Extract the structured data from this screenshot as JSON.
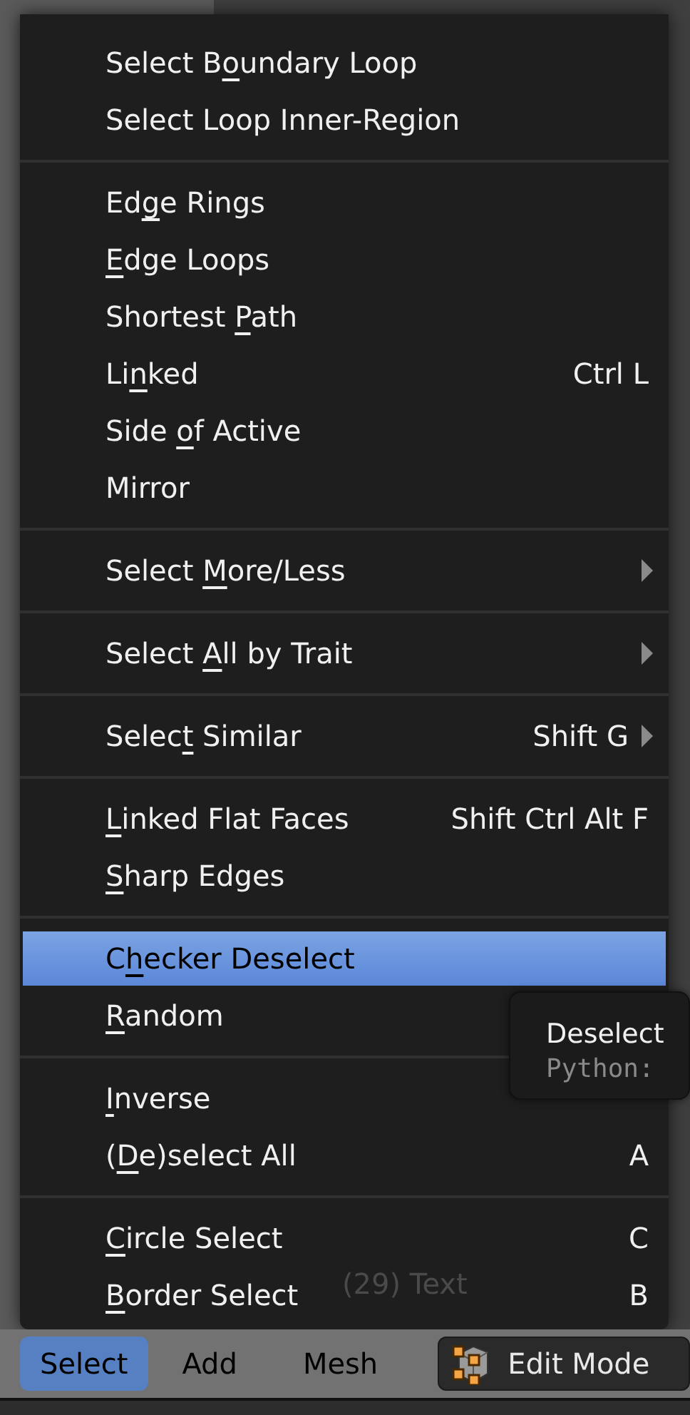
{
  "menu": {
    "sections": [
      {
        "items": [
          {
            "label_parts": [
              {
                "text": "Select B",
                "underlined": false
              },
              {
                "text": "o",
                "underlined": true
              },
              {
                "text": "undary Loop",
                "underlined": false
              }
            ],
            "selected": false,
            "submenu": false
          },
          {
            "label_parts": [
              {
                "text": "Select Loop Inner-Region",
                "underlined": false
              }
            ],
            "selected": false,
            "submenu": false
          }
        ]
      },
      {
        "items": [
          {
            "label_parts": [
              {
                "text": "Ed",
                "underlined": false
              },
              {
                "text": "g",
                "underlined": true
              },
              {
                "text": "e Rings",
                "underlined": false
              }
            ],
            "selected": false,
            "submenu": false
          },
          {
            "label_parts": [
              {
                "text": "E",
                "underlined": true
              },
              {
                "text": "dge Loops",
                "underlined": false
              }
            ],
            "selected": false,
            "submenu": false
          },
          {
            "label_parts": [
              {
                "text": "Shortest ",
                "underlined": false
              },
              {
                "text": "P",
                "underlined": true
              },
              {
                "text": "ath",
                "underlined": false
              }
            ],
            "selected": false,
            "submenu": false
          },
          {
            "label_parts": [
              {
                "text": "Li",
                "underlined": false
              },
              {
                "text": "n",
                "underlined": true
              },
              {
                "text": "ked",
                "underlined": false
              }
            ],
            "shortcut": "Ctrl L",
            "selected": false,
            "submenu": false
          },
          {
            "label_parts": [
              {
                "text": "Side ",
                "underlined": false
              },
              {
                "text": "o",
                "underlined": true
              },
              {
                "text": "f Active",
                "underlined": false
              }
            ],
            "selected": false,
            "submenu": false
          },
          {
            "label_parts": [
              {
                "text": "Mirror",
                "underlined": false
              }
            ],
            "selected": false,
            "submenu": false
          }
        ]
      },
      {
        "items": [
          {
            "label_parts": [
              {
                "text": "Select ",
                "underlined": false
              },
              {
                "text": "M",
                "underlined": true
              },
              {
                "text": "ore/Less",
                "underlined": false
              }
            ],
            "selected": false,
            "submenu": true
          }
        ]
      },
      {
        "items": [
          {
            "label_parts": [
              {
                "text": "Select ",
                "underlined": false
              },
              {
                "text": "A",
                "underlined": true
              },
              {
                "text": "ll by Trait",
                "underlined": false
              }
            ],
            "selected": false,
            "submenu": true
          }
        ]
      },
      {
        "items": [
          {
            "label_parts": [
              {
                "text": "Selec",
                "underlined": false
              },
              {
                "text": "t",
                "underlined": true
              },
              {
                "text": " Similar",
                "underlined": false
              }
            ],
            "shortcut": "Shift G",
            "selected": false,
            "submenu": true
          }
        ]
      },
      {
        "items": [
          {
            "label_parts": [
              {
                "text": "L",
                "underlined": true
              },
              {
                "text": "inked Flat Faces",
                "underlined": false
              }
            ],
            "shortcut": "Shift Ctrl Alt F",
            "selected": false,
            "submenu": false
          },
          {
            "label_parts": [
              {
                "text": "S",
                "underlined": true
              },
              {
                "text": "harp Edges",
                "underlined": false
              }
            ],
            "selected": false,
            "submenu": false
          }
        ]
      },
      {
        "items": [
          {
            "label_parts": [
              {
                "text": "C",
                "underlined": false
              },
              {
                "text": "h",
                "underlined": true
              },
              {
                "text": "ecker Deselect",
                "underlined": false
              }
            ],
            "selected": true,
            "submenu": false
          },
          {
            "label_parts": [
              {
                "text": "R",
                "underlined": true
              },
              {
                "text": "andom",
                "underlined": false
              }
            ],
            "selected": false,
            "submenu": false
          }
        ]
      },
      {
        "items": [
          {
            "label_parts": [
              {
                "text": "I",
                "underlined": true
              },
              {
                "text": "nverse",
                "underlined": false
              }
            ],
            "selected": false,
            "submenu": false
          },
          {
            "label_parts": [
              {
                "text": "(",
                "underlined": false
              },
              {
                "text": "D",
                "underlined": true
              },
              {
                "text": "e)select All",
                "underlined": false
              }
            ],
            "shortcut": "A",
            "selected": false,
            "submenu": false
          }
        ]
      },
      {
        "items": [
          {
            "label_parts": [
              {
                "text": "C",
                "underlined": true
              },
              {
                "text": "ircle Select",
                "underlined": false
              }
            ],
            "shortcut": "C",
            "selected": false,
            "submenu": false
          },
          {
            "label_parts": [
              {
                "text": "B",
                "underlined": true
              },
              {
                "text": "order Select",
                "underlined": false
              }
            ],
            "shortcut": "B",
            "selected": false,
            "submenu": false
          }
        ]
      }
    ]
  },
  "viewport_label": "(29) Text",
  "tooltip": {
    "title": "Deselect",
    "python_label": "Python:"
  },
  "header": {
    "menus": [
      {
        "label": "Select",
        "selected": true
      },
      {
        "label": "Add",
        "selected": false
      },
      {
        "label": "Mesh",
        "selected": false
      }
    ],
    "mode": {
      "label": "Edit Mode"
    }
  }
}
